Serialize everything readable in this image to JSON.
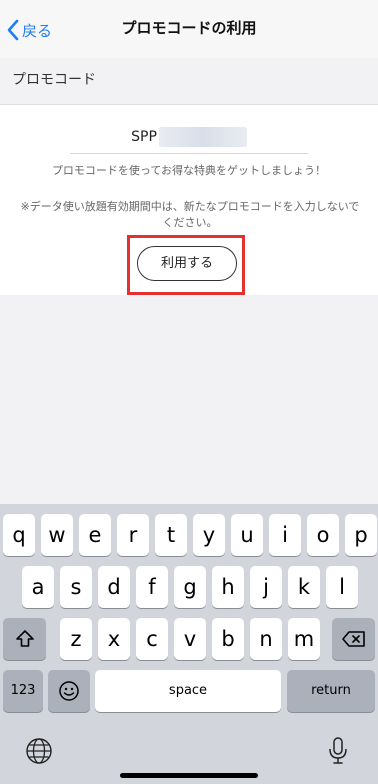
{
  "nav": {
    "back_label": "戻る",
    "title": "プロモコードの利用"
  },
  "section": {
    "label": "プロモコード"
  },
  "promo": {
    "code_prefix": "SPP",
    "description": "プロモコードを使ってお得な特典をゲットしましょう！",
    "note": "※データ使い放題有効期間中は、新たなプロモコードを入力しないでください。",
    "use_button": "利用する"
  },
  "keyboard": {
    "row1": [
      "q",
      "w",
      "e",
      "r",
      "t",
      "y",
      "u",
      "i",
      "o",
      "p"
    ],
    "row2": [
      "a",
      "s",
      "d",
      "f",
      "g",
      "h",
      "j",
      "k",
      "l"
    ],
    "row3": [
      "z",
      "x",
      "c",
      "v",
      "b",
      "n",
      "m"
    ],
    "numbers_key": "123",
    "space_key": "space",
    "return_key": "return"
  },
  "colors": {
    "accent": "#1f7cf4",
    "highlight": "#e53030",
    "keyboard_bg": "#d2d5db"
  }
}
